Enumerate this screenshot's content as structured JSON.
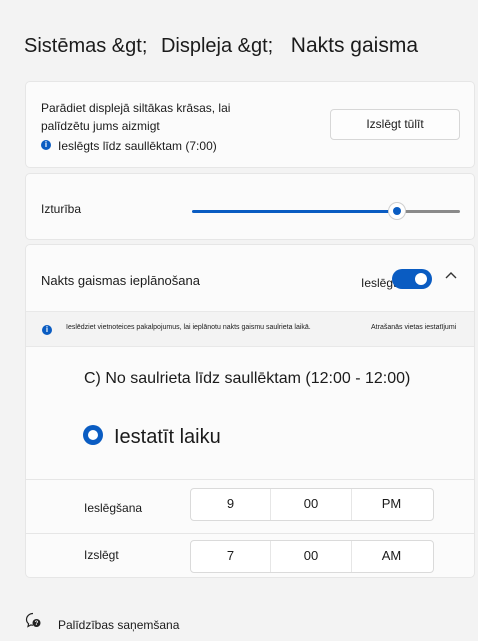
{
  "breadcrumb": {
    "part1": "Sistēmas &gt;",
    "part2": "Displeja &gt;",
    "current": "Nakts gaisma"
  },
  "card1": {
    "description_line1": "Parādiet displejā siltākas krāsas, lai",
    "description_line2": "palīdzētu jums aizmigt",
    "status": "Ieslēgts līdz saullēktam (7:00)",
    "button_label": "Izslēgt tūlīt"
  },
  "strength": {
    "label": "Izturība",
    "value_percent": 76
  },
  "schedule": {
    "title": "Nakts gaismas ieplānošana",
    "toggle_label": "Ieslēgts",
    "toggle_on": true,
    "info_text": "Ieslēdziet vietnoteices pakalpojumus, lai ieplānotu nakts gaismu saulrieta laikā.",
    "location_link": "Atrašanās vietas iestatījumi",
    "option_sunset": "C) No saulrieta līdz saullēktam (12:00 - 12:00)",
    "option_set_time": "Iestatīt laiku",
    "on_row": {
      "label": "Ieslēgšana",
      "hour": "9",
      "minute": "00",
      "period": "PM"
    },
    "off_row": {
      "label": "Izslēgt",
      "hour": "7",
      "minute": "00",
      "period": "AM"
    }
  },
  "help": {
    "label": "Palīdzības saņemšana"
  },
  "colors": {
    "accent": "#0a5cc2"
  }
}
